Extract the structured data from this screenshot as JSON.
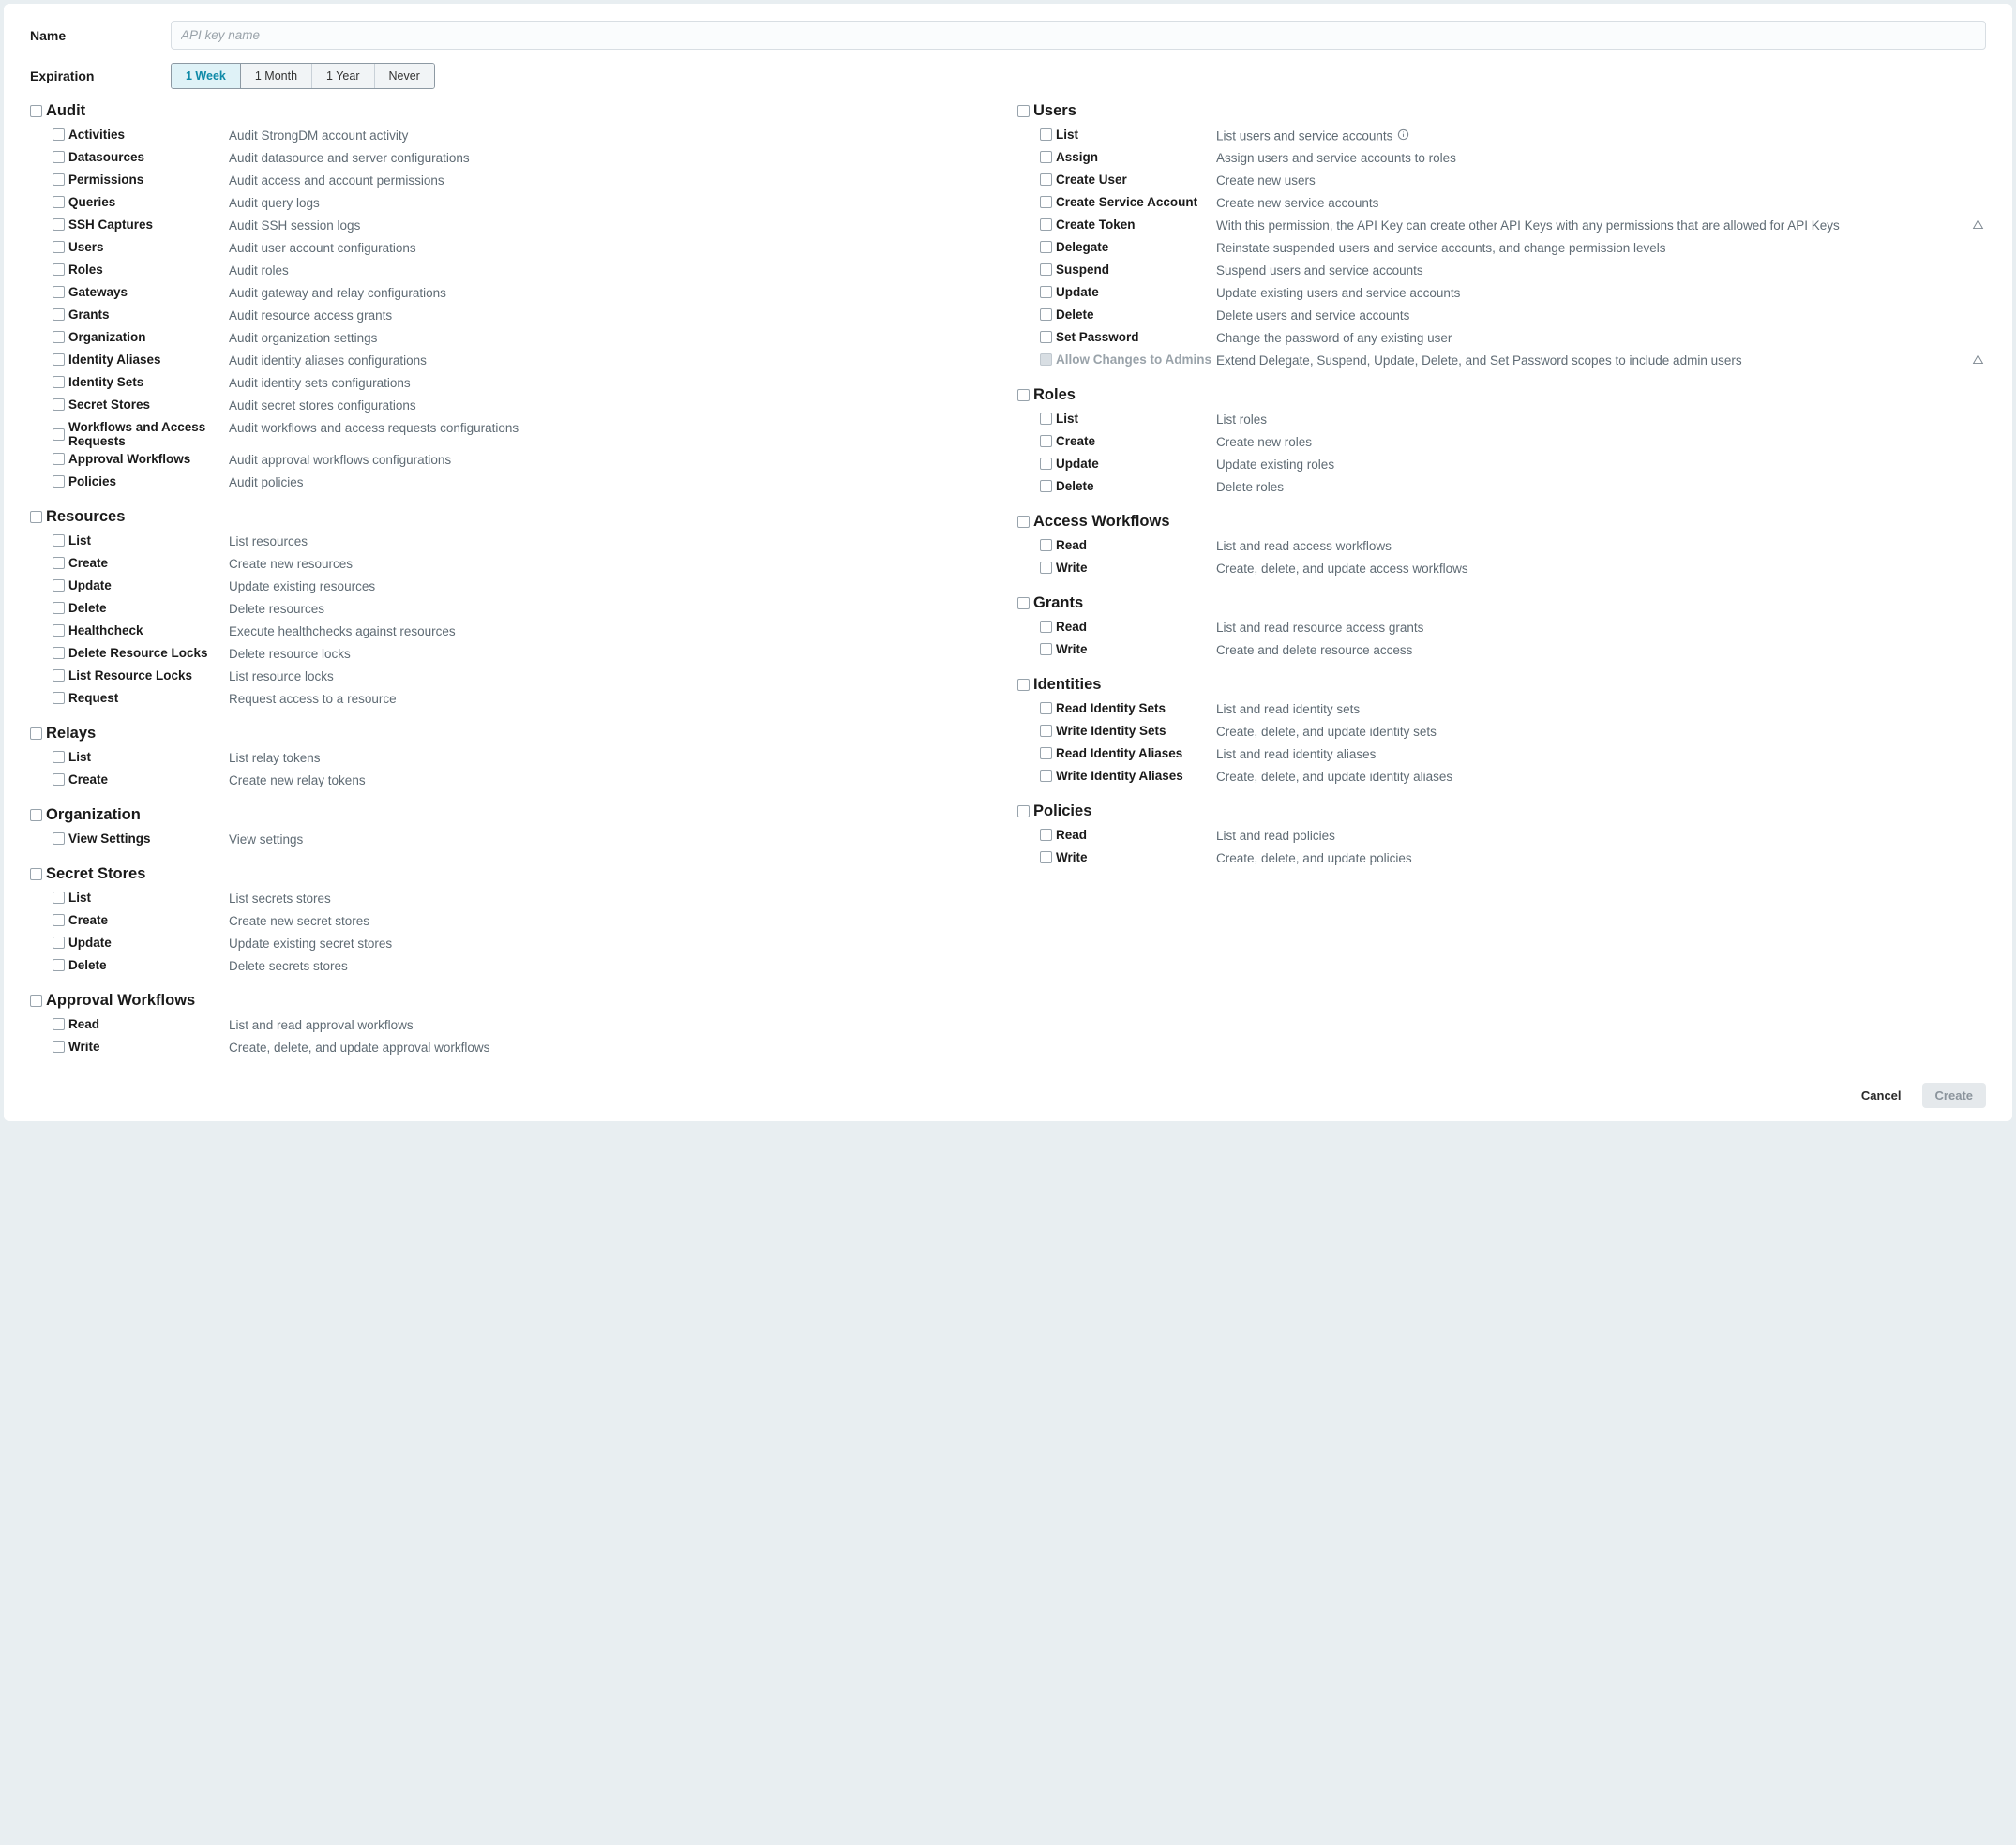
{
  "form": {
    "name_label": "Name",
    "name_placeholder": "API key name",
    "expiration_label": "Expiration",
    "expiration_options": [
      "1 Week",
      "1 Month",
      "1 Year",
      "Never"
    ],
    "expiration_selected": "1 Week"
  },
  "left_groups": [
    {
      "title": "Audit",
      "items": [
        {
          "name": "Activities",
          "desc": "Audit StrongDM account activity"
        },
        {
          "name": "Datasources",
          "desc": "Audit datasource and server configurations"
        },
        {
          "name": "Permissions",
          "desc": "Audit access and account permissions"
        },
        {
          "name": "Queries",
          "desc": "Audit query logs"
        },
        {
          "name": "SSH Captures",
          "desc": "Audit SSH session logs"
        },
        {
          "name": "Users",
          "desc": "Audit user account configurations"
        },
        {
          "name": "Roles",
          "desc": "Audit roles"
        },
        {
          "name": "Gateways",
          "desc": "Audit gateway and relay configurations"
        },
        {
          "name": "Grants",
          "desc": "Audit resource access grants"
        },
        {
          "name": "Organization",
          "desc": "Audit organization settings"
        },
        {
          "name": "Identity Aliases",
          "desc": "Audit identity aliases configurations"
        },
        {
          "name": "Identity Sets",
          "desc": "Audit identity sets configurations"
        },
        {
          "name": "Secret Stores",
          "desc": "Audit secret stores configurations"
        },
        {
          "name": "Workflows and Access Requests",
          "desc": "Audit workflows and access requests configurations"
        },
        {
          "name": "Approval Workflows",
          "desc": "Audit approval workflows configurations"
        },
        {
          "name": "Policies",
          "desc": "Audit policies"
        }
      ]
    },
    {
      "title": "Resources",
      "items": [
        {
          "name": "List",
          "desc": "List resources"
        },
        {
          "name": "Create",
          "desc": "Create new resources"
        },
        {
          "name": "Update",
          "desc": "Update existing resources"
        },
        {
          "name": "Delete",
          "desc": "Delete resources"
        },
        {
          "name": "Healthcheck",
          "desc": "Execute healthchecks against resources"
        },
        {
          "name": "Delete Resource Locks",
          "desc": "Delete resource locks"
        },
        {
          "name": "List Resource Locks",
          "desc": "List resource locks"
        },
        {
          "name": "Request",
          "desc": "Request access to a resource"
        }
      ]
    },
    {
      "title": "Relays",
      "items": [
        {
          "name": "List",
          "desc": "List relay tokens"
        },
        {
          "name": "Create",
          "desc": "Create new relay tokens"
        }
      ]
    },
    {
      "title": "Organization",
      "items": [
        {
          "name": "View Settings",
          "desc": "View settings"
        }
      ]
    },
    {
      "title": "Secret Stores",
      "items": [
        {
          "name": "List",
          "desc": "List secrets stores"
        },
        {
          "name": "Create",
          "desc": "Create new secret stores"
        },
        {
          "name": "Update",
          "desc": "Update existing secret stores"
        },
        {
          "name": "Delete",
          "desc": "Delete secrets stores"
        }
      ]
    },
    {
      "title": "Approval Workflows",
      "items": [
        {
          "name": "Read",
          "desc": "List and read approval workflows"
        },
        {
          "name": "Write",
          "desc": "Create, delete, and update approval workflows"
        }
      ]
    }
  ],
  "right_groups": [
    {
      "title": "Users",
      "items": [
        {
          "name": "List",
          "desc": "List users and service accounts",
          "info": true
        },
        {
          "name": "Assign",
          "desc": "Assign users and service accounts to roles"
        },
        {
          "name": "Create User",
          "desc": "Create new users"
        },
        {
          "name": "Create Service Account",
          "desc": "Create new service accounts"
        },
        {
          "name": "Create Token",
          "desc": "With this permission, the API Key can create other API Keys with any permissions that are allowed for API Keys",
          "warn": true
        },
        {
          "name": "Delegate",
          "desc": "Reinstate suspended users and service accounts, and change permission levels"
        },
        {
          "name": "Suspend",
          "desc": "Suspend users and service accounts"
        },
        {
          "name": "Update",
          "desc": "Update existing users and service accounts"
        },
        {
          "name": "Delete",
          "desc": "Delete users and service accounts"
        },
        {
          "name": "Set Password",
          "desc": "Change the password of any existing user"
        },
        {
          "name": "Allow Changes to Admins",
          "desc": "Extend Delegate, Suspend, Update, Delete, and Set Password scopes to include admin users",
          "disabled": true,
          "warn": true
        }
      ]
    },
    {
      "title": "Roles",
      "items": [
        {
          "name": "List",
          "desc": "List roles"
        },
        {
          "name": "Create",
          "desc": "Create new roles"
        },
        {
          "name": "Update",
          "desc": "Update existing roles"
        },
        {
          "name": "Delete",
          "desc": "Delete roles"
        }
      ]
    },
    {
      "title": "Access Workflows",
      "items": [
        {
          "name": "Read",
          "desc": "List and read access workflows"
        },
        {
          "name": "Write",
          "desc": "Create, delete, and update access workflows"
        }
      ]
    },
    {
      "title": "Grants",
      "items": [
        {
          "name": "Read",
          "desc": "List and read resource access grants"
        },
        {
          "name": "Write",
          "desc": "Create and delete resource access"
        }
      ]
    },
    {
      "title": "Identities",
      "items": [
        {
          "name": "Read Identity Sets",
          "desc": "List and read identity sets"
        },
        {
          "name": "Write Identity Sets",
          "desc": "Create, delete, and update identity sets"
        },
        {
          "name": "Read Identity Aliases",
          "desc": "List and read identity aliases"
        },
        {
          "name": "Write Identity Aliases",
          "desc": "Create, delete, and update identity aliases"
        }
      ]
    },
    {
      "title": "Policies",
      "items": [
        {
          "name": "Read",
          "desc": "List and read policies"
        },
        {
          "name": "Write",
          "desc": "Create, delete, and update policies"
        }
      ]
    }
  ],
  "footer": {
    "cancel": "Cancel",
    "create": "Create"
  }
}
